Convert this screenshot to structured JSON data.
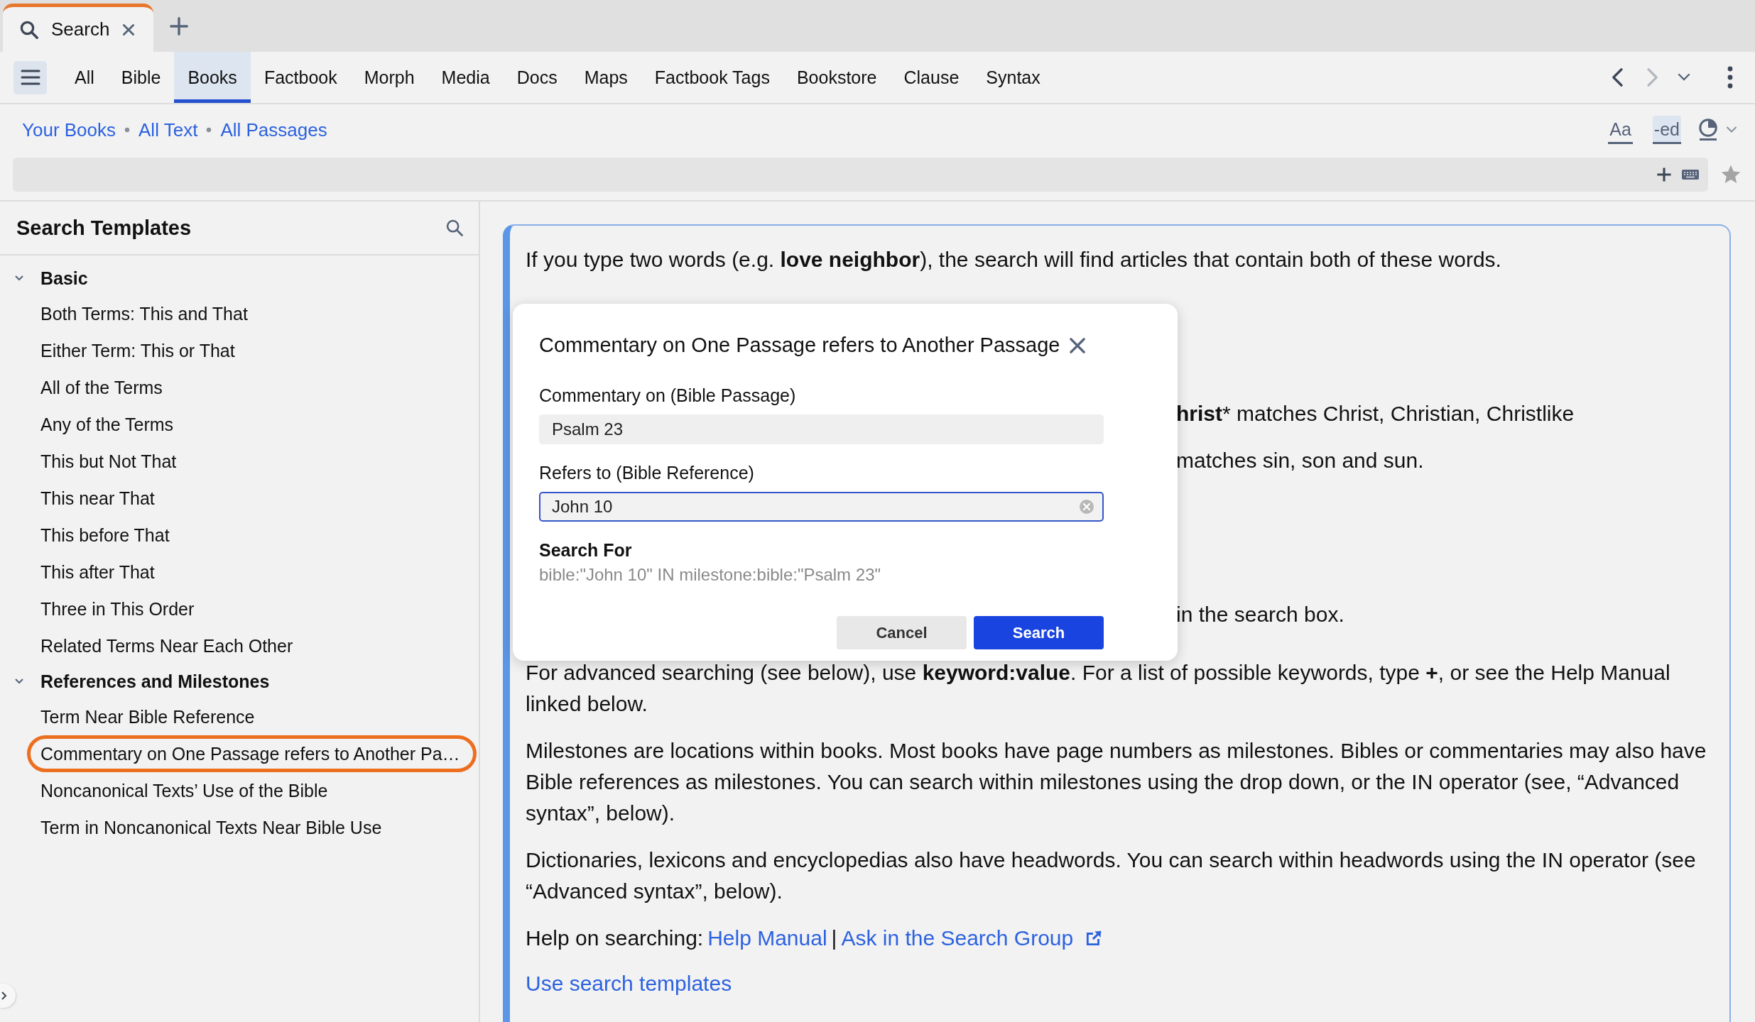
{
  "tabs": [
    {
      "label": "Search",
      "selected": true
    }
  ],
  "nav": {
    "items": [
      {
        "label": "All",
        "selected": false
      },
      {
        "label": "Bible",
        "selected": false
      },
      {
        "label": "Books",
        "selected": true
      },
      {
        "label": "Factbook",
        "selected": false
      },
      {
        "label": "Morph",
        "selected": false
      },
      {
        "label": "Media",
        "selected": false
      },
      {
        "label": "Docs",
        "selected": false
      },
      {
        "label": "Maps",
        "selected": false
      },
      {
        "label": "Factbook Tags",
        "selected": false
      },
      {
        "label": "Bookstore",
        "selected": false
      },
      {
        "label": "Clause",
        "selected": false
      },
      {
        "label": "Syntax",
        "selected": false
      }
    ],
    "forward_disabled": true
  },
  "breadcrumb": [
    "Your Books",
    "All Text",
    "All Passages"
  ],
  "format_buttons": [
    {
      "label": "Aa",
      "selected": false
    },
    {
      "label": "-ed",
      "selected": true
    }
  ],
  "sidebar": {
    "title": "Search Templates",
    "groups": [
      {
        "label": "Basic",
        "expanded": true,
        "children": [
          {
            "label": "Both Terms: This and That",
            "selected": false
          },
          {
            "label": "Either Term: This or That",
            "selected": false
          },
          {
            "label": "All of the Terms",
            "selected": false
          },
          {
            "label": "Any of the Terms",
            "selected": false
          },
          {
            "label": "This but Not That",
            "selected": false
          },
          {
            "label": "This near That",
            "selected": false
          },
          {
            "label": "This before That",
            "selected": false
          },
          {
            "label": "This after That",
            "selected": false
          },
          {
            "label": "Three in This Order",
            "selected": false
          },
          {
            "label": "Related Terms Near Each Other",
            "selected": false
          }
        ]
      },
      {
        "label": "References and Milestones",
        "expanded": true,
        "children": [
          {
            "label": "Term Near Bible Reference",
            "selected": false
          },
          {
            "label": "Commentary on One Passage refers to Another Pa…",
            "selected": true
          },
          {
            "label": "Noncanonical Texts’ Use of the Bible",
            "selected": false
          },
          {
            "label": "Term in Noncanonical Texts Near Bible Use",
            "selected": false
          }
        ]
      }
    ]
  },
  "content": {
    "paragraphs": [
      {
        "kind": "text",
        "runs": [
          {
            "text": "If you type two words (e.g. ",
            "bold": false
          },
          {
            "text": "love neighbor",
            "bold": true
          },
          {
            "text": "), the search will find articles that contain both of these words.",
            "bold": false
          }
        ]
      },
      {
        "kind": "fragment",
        "runs": [
          {
            "text": "hrist",
            "bold": true
          },
          {
            "text": "* matches Christ, Christian, Christlike",
            "bold": false
          }
        ]
      },
      {
        "kind": "fragment",
        "runs": [
          {
            "text": "matches sin, son and sun.",
            "bold": false
          }
        ]
      },
      {
        "kind": "fragment",
        "runs": [
          {
            "text": "in the search box.",
            "bold": false
          }
        ]
      },
      {
        "kind": "text",
        "runs": [
          {
            "text": "For advanced searching (see below), use ",
            "bold": false
          },
          {
            "text": "keyword:value",
            "bold": true
          },
          {
            "text": ". For a list of possible keywords, type ",
            "bold": false
          },
          {
            "text": "+",
            "bold": true
          },
          {
            "text": ", or see the Help Manual linked below.",
            "bold": false
          }
        ]
      },
      {
        "kind": "text",
        "runs": [
          {
            "text": "Milestones are locations within books. Most books have page numbers as milestones. Bibles or commentaries may also have Bible references as milestones. You can search within milestones using the drop down, or the IN operator (see, “Advanced syntax”, below).",
            "bold": false
          }
        ]
      },
      {
        "kind": "text",
        "runs": [
          {
            "text": "Dictionaries, lexicons and encyclopedias also have headwords. You can search within headwords using the IN operator (see “Advanced syntax”, below).",
            "bold": false
          }
        ]
      }
    ],
    "help": {
      "label": "Help on searching:",
      "links": [
        "Help Manual",
        "Ask in the Search Group"
      ],
      "separator": "|"
    },
    "templates_link": "Use search templates"
  },
  "dialog": {
    "title": "Commentary on One Passage refers to Another Passage",
    "fields": [
      {
        "label": "Commentary on (Bible Passage)",
        "value": "Psalm 23",
        "focused": false
      },
      {
        "label": "Refers to (Bible Reference)",
        "value": "John 10",
        "focused": true
      }
    ],
    "search_for_label": "Search For",
    "query": "bible:\"John 10\" IN milestone:bible:\"Psalm 23\"",
    "buttons": [
      {
        "label": "Cancel",
        "kind": "secondary"
      },
      {
        "label": "Search",
        "kind": "primary"
      }
    ]
  }
}
